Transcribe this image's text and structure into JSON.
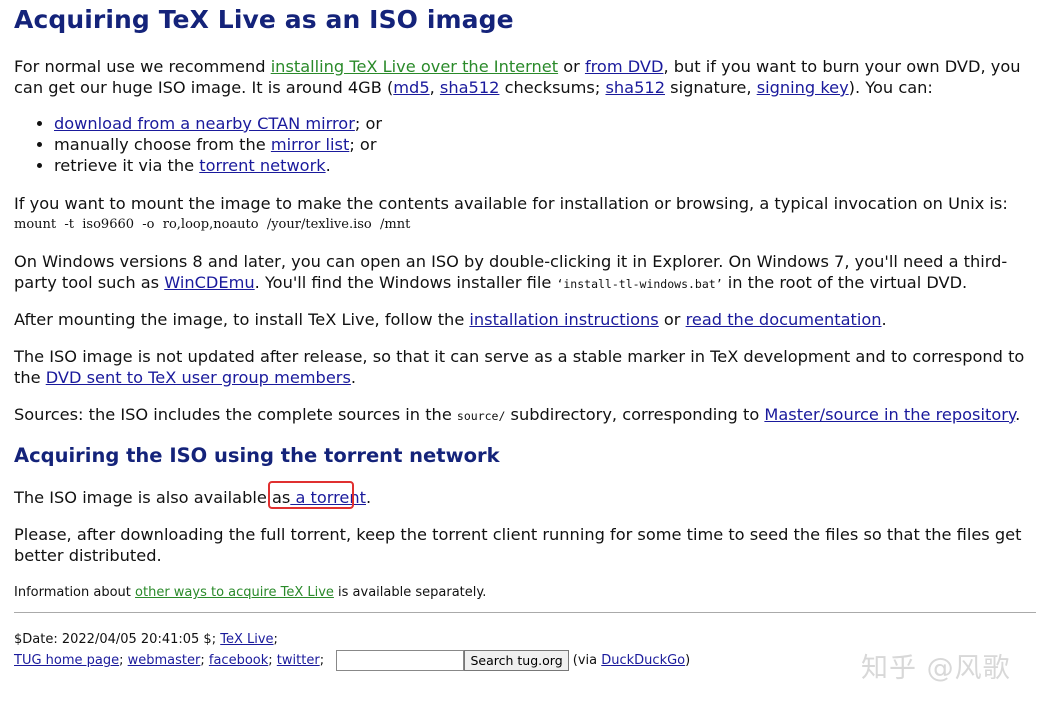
{
  "title": "Acquiring TeX Live as an ISO image",
  "intro": {
    "t1": "For normal use we recommend ",
    "link_net": "installing TeX Live over the Internet",
    "t2": " or ",
    "link_dvd": "from DVD",
    "t3": ", but if you want to burn your own DVD, you can get our huge ISO image. It is around 4GB (",
    "link_md5": "md5",
    "t4": ", ",
    "link_sha512": "sha512",
    "t5": " checksums; ",
    "link_sha512_sig": "sha512",
    "t6": " signature, ",
    "link_key": "signing key",
    "t7": "). You can:"
  },
  "list": {
    "i1_link": "download from a nearby CTAN mirror",
    "i1_after": "; or",
    "i2_before": "manually choose from the ",
    "i2_link": "mirror list",
    "i2_after": "; or",
    "i3_before": "retrieve it via the ",
    "i3_link": "torrent network",
    "i3_after": "."
  },
  "mount": {
    "text": "If you want to mount the image to make the contents available for installation or browsing, a typical invocation on Unix is:",
    "code": "mount  -t  iso9660  -o  ro,loop,noauto  /your/texlive.iso  /mnt"
  },
  "windows": {
    "t1": "On Windows versions 8 and later, you can open an ISO by double-clicking it in Explorer. On Windows 7, you'll need a third-party tool such as ",
    "link": "WinCDEmu",
    "t2": ". You'll find the Windows installer file  ",
    "file": "‘install-tl-windows.bat’",
    "t3": "  in the root of the virtual DVD."
  },
  "after": {
    "t1": "After mounting the image, to install TeX Live, follow the ",
    "link1": "installation instructions",
    "t2": " or ",
    "link2": "read the documentation",
    "t3": "."
  },
  "notupdated": {
    "t1": "The ISO image is not updated after release, so that it can serve as a stable marker in TeX development and to correspond to the ",
    "link": "DVD sent to TeX user group members",
    "t2": "."
  },
  "sources": {
    "t1": "Sources: the ISO includes the complete sources in the ",
    "dir": "source/",
    "t2": " subdirectory, corresponding to ",
    "link": "Master/source in the repository",
    "t3": "."
  },
  "h2": "Acquiring the ISO using the torrent network",
  "torrent": {
    "t1": "The ISO image is also available as",
    "link": " a torrent",
    "t2": "."
  },
  "seed": "Please, after downloading the full torrent, keep the torrent client running for some time to seed the files so that the files get better distributed.",
  "info": {
    "t1": "Information about ",
    "link": "other ways to acquire TeX Live",
    "t2": " is available separately."
  },
  "footer": {
    "date": "$Date: 2022/04/05 20:41:05 $; ",
    "texlive": "TeX Live",
    "semi": ";",
    "tug": "TUG home page",
    "webmaster": "webmaster",
    "facebook": "facebook",
    "twitter": "twitter",
    "sep": "; ",
    "search_value": "",
    "search_button": "Search tug.org",
    "via": " (via ",
    "ddg": "DuckDuckGo",
    "close": ")"
  },
  "watermark": "知乎 @风歌",
  "colors": {
    "heading": "#14237a",
    "link": "#1a1a9c",
    "visited_link": "#2a8a2a",
    "highlight": "#e03030"
  }
}
